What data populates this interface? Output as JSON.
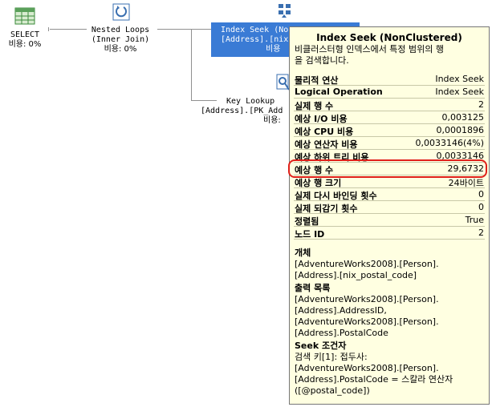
{
  "plan": {
    "select": {
      "name": "SELECT",
      "cost": "비용: 0%"
    },
    "nested_loops": {
      "name": "Nested Loops",
      "sub": "(Inner Join)",
      "cost": "비용: 0%"
    },
    "index_seek": {
      "name": "Index Seek (No",
      "sub": "[Address].[nix",
      "cost": "비용"
    },
    "key_lookup": {
      "name": "Key Lookup",
      "sub": "[Address].[PK_Add",
      "cost": "비용:"
    }
  },
  "tooltip": {
    "title": "Index Seek (NonClustered)",
    "description_lines": [
      "비클러스터형 인덱스에서 특정 범위의 행",
      "을 검색합니다."
    ],
    "rows": [
      {
        "label": "물리적 연산",
        "value": "Index Seek"
      },
      {
        "label": "Logical Operation",
        "value": "Index Seek"
      },
      {
        "label": "실제 행 수",
        "value": "2"
      },
      {
        "label": "예상 I/O 비용",
        "value": "0,003125"
      },
      {
        "label": "예상 CPU 비용",
        "value": "0,0001896"
      },
      {
        "label": "예상 연산자 비용",
        "value": "0,0033146(4%)"
      },
      {
        "label": "예상 하위 트리 비용",
        "value": "0,0033146"
      },
      {
        "label": "예상 행 수",
        "value": "29,6732"
      },
      {
        "label": "예상 행 크기",
        "value": "24바이트"
      },
      {
        "label": "실제 다시 바인딩 횟수",
        "value": "0"
      },
      {
        "label": "실제 되감기 횟수",
        "value": "0"
      },
      {
        "label": "정렬됨",
        "value": "True"
      },
      {
        "label": "노드 ID",
        "value": "2"
      }
    ],
    "object": {
      "heading": "개체",
      "lines": [
        "[AdventureWorks2008].[Person].",
        "[Address].[nix_postal_code]"
      ]
    },
    "output": {
      "heading": "출력 목록",
      "lines": [
        "[AdventureWorks2008].[Person].",
        "[Address].AddressID,",
        "[AdventureWorks2008].[Person].",
        "[Address].PostalCode"
      ]
    },
    "seek": {
      "heading": "Seek 조건자",
      "lines": [
        "검색 키[1]: 접두사:",
        "[AdventureWorks2008].[Person].",
        "[Address].PostalCode  = 스칼라 연산자",
        "([@postal_code])"
      ]
    }
  },
  "colors": {
    "selection": "#3a7bd5",
    "tooltip_bg": "#ffffe1",
    "highlight": "#e0201a"
  }
}
